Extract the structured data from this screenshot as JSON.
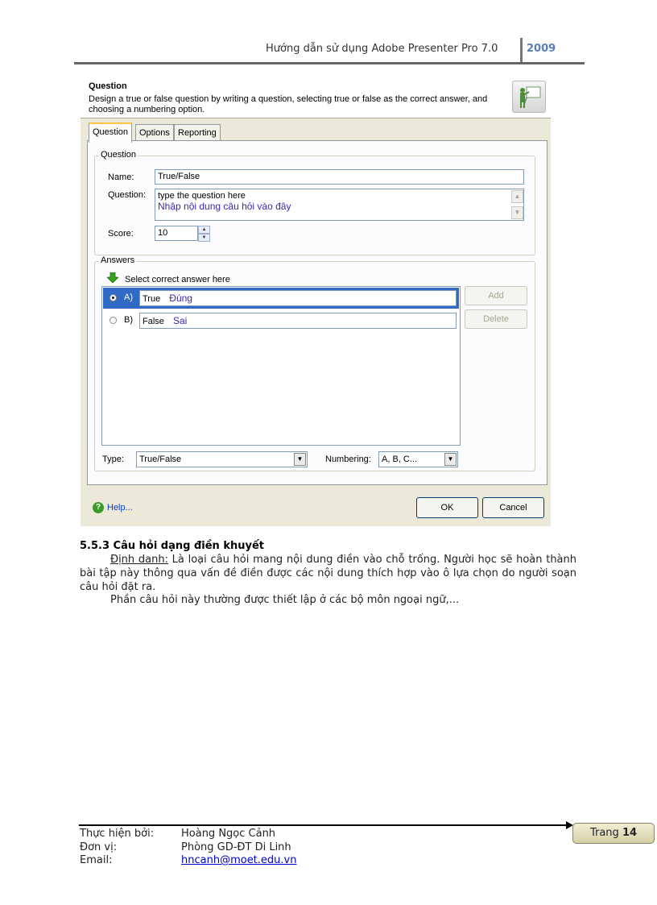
{
  "header": {
    "title": "Hướng dẫn sử dụng Adobe Presenter Pro 7.0",
    "year": "2009"
  },
  "dialog": {
    "heading": "Question",
    "description": "Design a true or false question by writing a question, selecting true or false as the correct answer, and choosing a numbering option.",
    "tabs": [
      {
        "label": "Question",
        "active": true
      },
      {
        "label": "Options",
        "active": false
      },
      {
        "label": "Reporting",
        "active": false
      }
    ],
    "question_group": {
      "legend": "Question",
      "name_label": "Name:",
      "name_value": "True/False",
      "question_label": "Question:",
      "question_value": "type the question here",
      "question_note": "Nhập nội dung câu hỏi vào đây",
      "score_label": "Score:",
      "score_value": "10"
    },
    "answers_group": {
      "legend": "Answers",
      "hint": "Select correct answer here",
      "rows": [
        {
          "letter": "A)",
          "value": "True",
          "note": "Đúng",
          "selected": true
        },
        {
          "letter": "B)",
          "value": "False",
          "note": "Sai",
          "selected": false
        }
      ],
      "add_label": "Add",
      "delete_label": "Delete"
    },
    "type_label": "Type:",
    "type_value": "True/False",
    "numbering_label": "Numbering:",
    "numbering_value": "A, B, C...",
    "help_label": "Help...",
    "ok_label": "OK",
    "cancel_label": "Cancel"
  },
  "section": {
    "title": "5.5.3 Câu hỏi dạng điền khuyết",
    "definition_term": "Định danh:",
    "definition_text": " Là loại câu hỏi mang nội dung điền vào chỗ trống. Người học sẽ hoàn thành bài tập này thông qua vấn đề điền được các nội dung thích hợp vào ô lựa chọn do người soạn câu hỏi đặt ra.",
    "paragraph2": "Phần câu hỏi này thường được thiết lập ở các bộ môn ngoại ngữ,..."
  },
  "footer": {
    "author_label": "Thực hiện bởi:",
    "author_value": "Hoàng Ngọc Cảnh",
    "unit_label": "Đơn vị:",
    "unit_value": "Phòng GD-ĐT Di Linh",
    "email_label": "Email:",
    "email_value": "hncanh@moet.edu.vn",
    "page_label": "Trang",
    "page_number": "14"
  }
}
